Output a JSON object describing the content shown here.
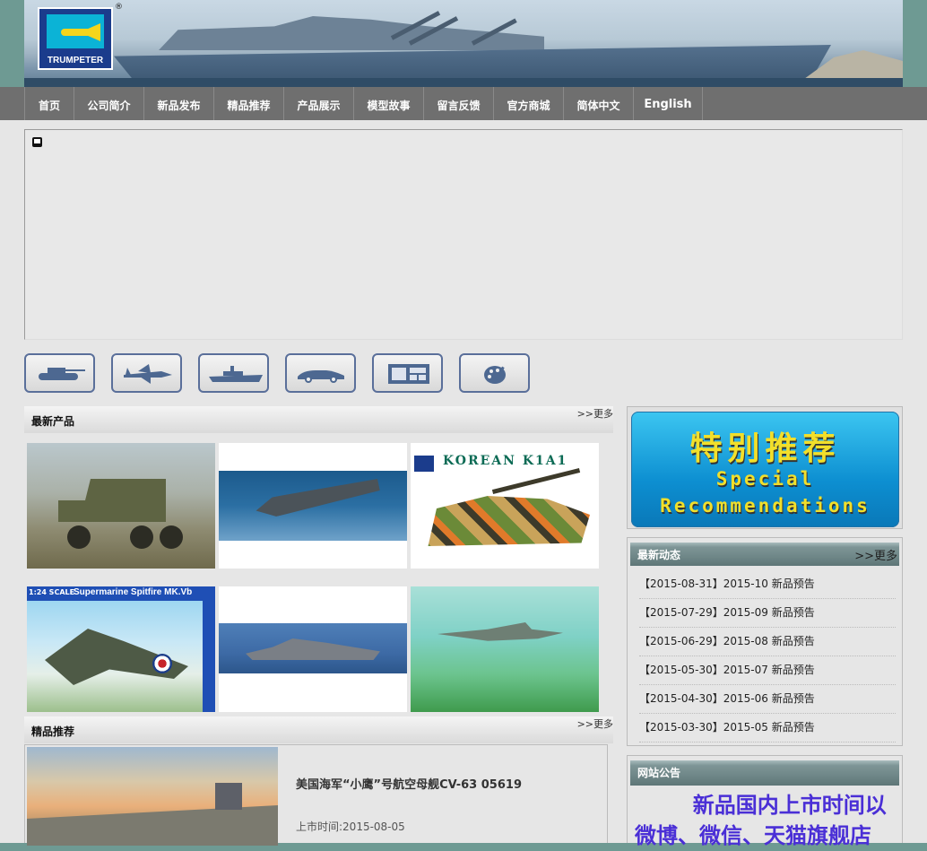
{
  "logo": {
    "text": "TRUMPETER",
    "reg_mark": "®"
  },
  "nav": {
    "items": [
      "首页",
      "公司简介",
      "新品发布",
      "精品推荐",
      "产品展示",
      "模型故事",
      "留言反馈",
      "官方商城",
      "简体中文",
      "English"
    ]
  },
  "categories": [
    "tank-icon",
    "jet-icon",
    "warship-icon",
    "car-icon",
    "gallery-icon",
    "paint-palette-icon"
  ],
  "latest": {
    "title": "最新产品",
    "more": ">>更多"
  },
  "featured": {
    "section_title": "精品推荐",
    "more": ">>更多",
    "item_title": "美国海军“小鹰”号航空母舰CV-63 05619",
    "item_date": "上市时间:2015-08-05"
  },
  "special": {
    "cn": "特别推荐",
    "en_line1": "Special",
    "en_line2": "Recommendations"
  },
  "news": {
    "title": "最新动态",
    "more": ">>更多",
    "items": [
      "【2015-08-31】2015-10 新品预告",
      "【2015-07-29】2015-09 新品预告",
      "【2015-06-29】2015-08 新品预告",
      "【2015-05-30】2015-07 新品预告",
      "【2015-04-30】2015-06 新品预告",
      "【2015-03-30】2015-05 新品预告"
    ]
  },
  "notice": {
    "title": "网站公告",
    "text": "新品国内上市时间以微博、微信、天猫旗舰店"
  },
  "thumbs": {
    "row1": [
      "rocket-launcher-truck",
      "destroyer-at-sea",
      "korean-k1a1-tank"
    ],
    "row2": [
      "supermarine-spitfire-box",
      "cruiser-at-sea",
      "jet-fighter-flight"
    ],
    "k1a1_label": "KOREAN K1A1",
    "spitfire_label": "Supermarine Spitfire MK.Vb",
    "spitfire_scale": "1:24 SCALE"
  }
}
